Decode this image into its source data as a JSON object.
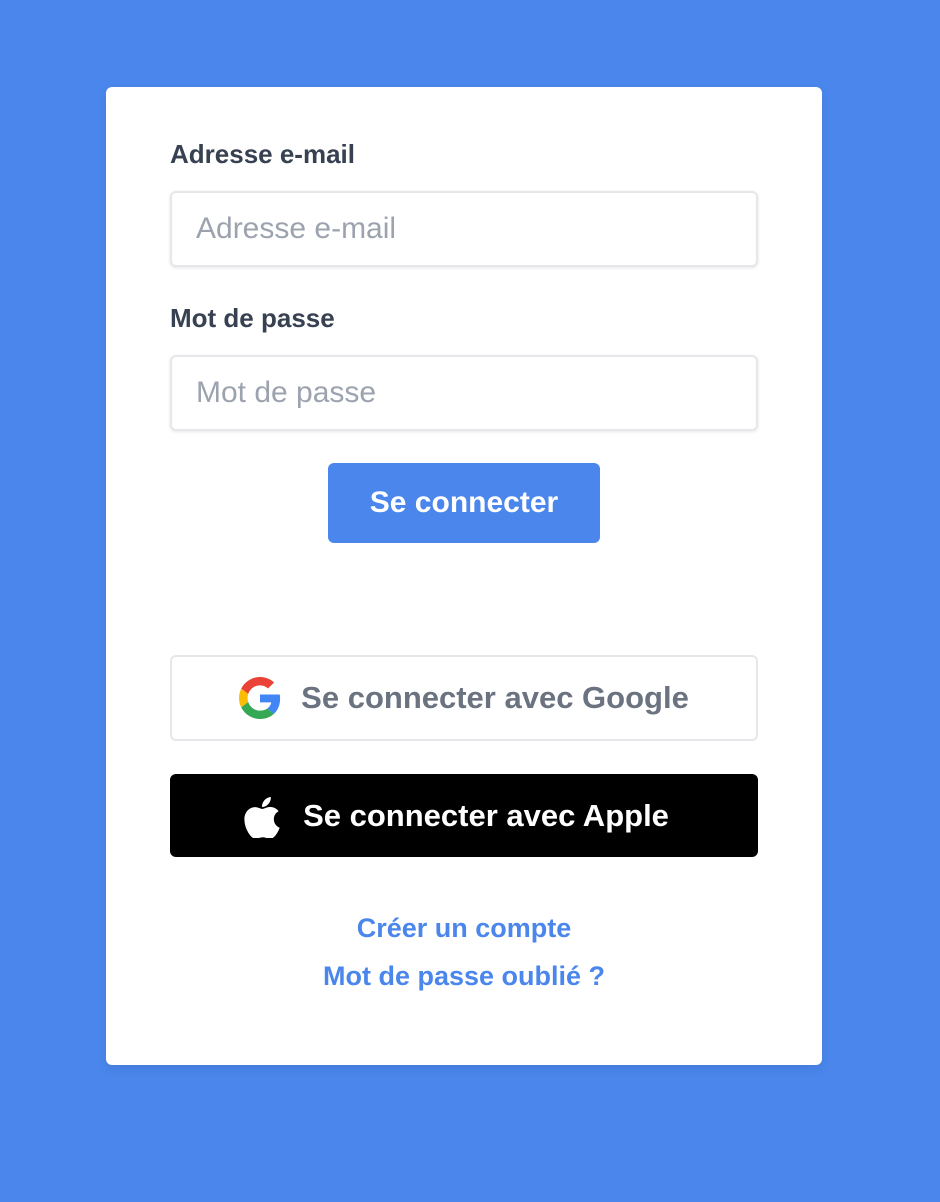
{
  "form": {
    "email_label": "Adresse e-mail",
    "email_placeholder": "Adresse e-mail",
    "email_value": "",
    "password_label": "Mot de passe",
    "password_placeholder": "Mot de passe",
    "password_value": "",
    "submit_label": "Se connecter"
  },
  "social": {
    "google_label": "Se connecter avec Google",
    "google_icon": "google-logo",
    "apple_label": "Se connecter avec Apple",
    "apple_icon": "apple-logo"
  },
  "links": {
    "create_account": "Créer un compte",
    "forgot_password": "Mot de passe oublié ?"
  },
  "colors": {
    "background": "#4a86ec",
    "accent": "#4a86ec",
    "apple_button": "#000000"
  }
}
